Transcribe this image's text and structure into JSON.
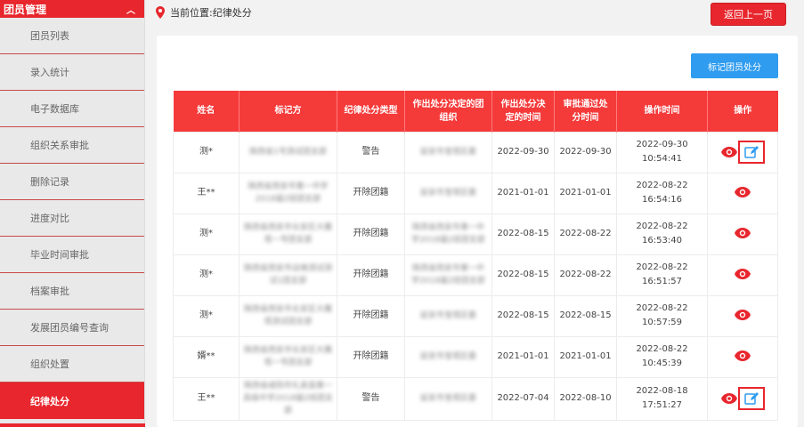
{
  "sidebar": {
    "header": "团员管理",
    "items": [
      {
        "label": "团员列表",
        "active": false
      },
      {
        "label": "录入统计",
        "active": false
      },
      {
        "label": "电子数据库",
        "active": false
      },
      {
        "label": "组织关系审批",
        "active": false
      },
      {
        "label": "删除记录",
        "active": false
      },
      {
        "label": "进度对比",
        "active": false
      },
      {
        "label": "毕业时间审批",
        "active": false
      },
      {
        "label": "档案审批",
        "active": false
      },
      {
        "label": "发展团员编号查询",
        "active": false
      },
      {
        "label": "组织处置",
        "active": false
      },
      {
        "label": "纪律处分",
        "active": true
      }
    ]
  },
  "breadcrumb": "当前位置:纪律处分",
  "back_button": "返回上一页",
  "mark_button": "标记团员处分",
  "table": {
    "headers": [
      "姓名",
      "标记方",
      "纪律处分类型",
      "作出处分决定的团组织",
      "作出处分决定的时间",
      "审批通过处分时间",
      "操作时间",
      "操作"
    ],
    "rows": [
      {
        "name": "测*",
        "marker": "陕西省1号测试团支部",
        "type": "警告",
        "org": "延安市宝塔区委",
        "decided": "2022-09-30",
        "approved": "2022-09-30",
        "op_time": "2022-09-30 10:54:41",
        "edit": true
      },
      {
        "name": "王**",
        "marker": "陕西省西安市第一中学2018届2班团支部",
        "type": "开除团籍",
        "org": "延安市宝塔区委",
        "decided": "2021-01-01",
        "approved": "2021-01-01",
        "op_time": "2022-08-22 16:54:16",
        "edit": false
      },
      {
        "name": "测*",
        "marker": "陕西省西安市长安区大雁塔一号团支部",
        "type": "开除团籍",
        "org": "陕西省西安市第一中学2018届2班团支部",
        "decided": "2022-08-15",
        "approved": "2022-08-22",
        "op_time": "2022-08-22 16:53:40",
        "edit": false
      },
      {
        "name": "测*",
        "marker": "陕西省西安市运维测试测试1团支部",
        "type": "开除团籍",
        "org": "陕西省西安市第一中学2018届2班团支部",
        "decided": "2022-08-15",
        "approved": "2022-08-22",
        "op_time": "2022-08-22 16:51:57",
        "edit": false
      },
      {
        "name": "测*",
        "marker": "陕西省西安市长安区大雁塔测试团支部",
        "type": "开除团籍",
        "org": "延安市宝塔区委",
        "decided": "2022-08-15",
        "approved": "2022-08-15",
        "op_time": "2022-08-22 10:57:59",
        "edit": false
      },
      {
        "name": "婿**",
        "marker": "陕西省西安市长安区大雁塔一号团支部",
        "type": "开除团籍",
        "org": "延安市宝塔区委",
        "decided": "2021-01-01",
        "approved": "2021-01-01",
        "op_time": "2022-08-22 10:45:39",
        "edit": false
      },
      {
        "name": "王**",
        "marker": "陕西省咸阳市礼泉县第一高级中学2018届2班团支部",
        "type": "警告",
        "org": "延安市宝塔区委",
        "decided": "2022-07-04",
        "approved": "2022-08-10",
        "op_time": "2022-08-18 17:51:27",
        "edit": true
      }
    ]
  },
  "colors": {
    "accent": "#e8262d",
    "header_bg": "#f53a3a",
    "primary_button": "#2f9cef"
  },
  "icons": {
    "location": "location-pin-icon",
    "view": "eye-icon",
    "edit": "edit-icon",
    "collapse": "chevron-up-icon"
  }
}
